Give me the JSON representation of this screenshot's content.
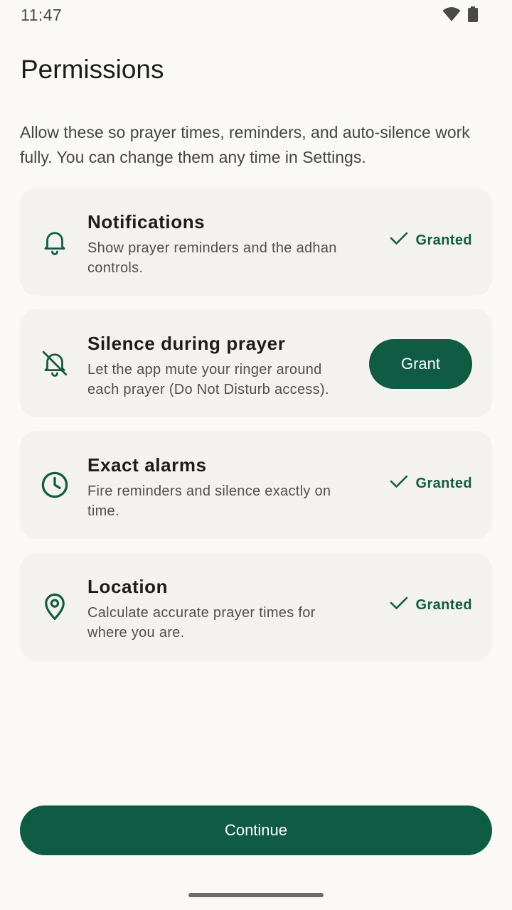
{
  "status_bar": {
    "time": "11:47"
  },
  "page": {
    "title": "Permissions",
    "intro": "Allow these so prayer times, reminders, and auto-silence work fully. You can change them any time in Settings."
  },
  "permissions": [
    {
      "icon": "bell-icon",
      "title": "Notifications",
      "description": "Show prayer reminders and the adhan controls.",
      "status": "Granted"
    },
    {
      "icon": "bell-off-icon",
      "title": "Silence during prayer",
      "description": "Let the app mute your ringer around each prayer (Do Not Disturb access).",
      "action": "Grant"
    },
    {
      "icon": "clock-icon",
      "title": "Exact alarms",
      "description": "Fire reminders and silence exactly on time.",
      "status": "Granted"
    },
    {
      "icon": "location-pin-icon",
      "title": "Location",
      "description": "Calculate accurate prayer times for where you are.",
      "status": "Granted"
    }
  ],
  "continue_label": "Continue",
  "colors": {
    "accent": "#0f5b44",
    "background": "#faf9f6",
    "card": "#f4f2ee"
  }
}
